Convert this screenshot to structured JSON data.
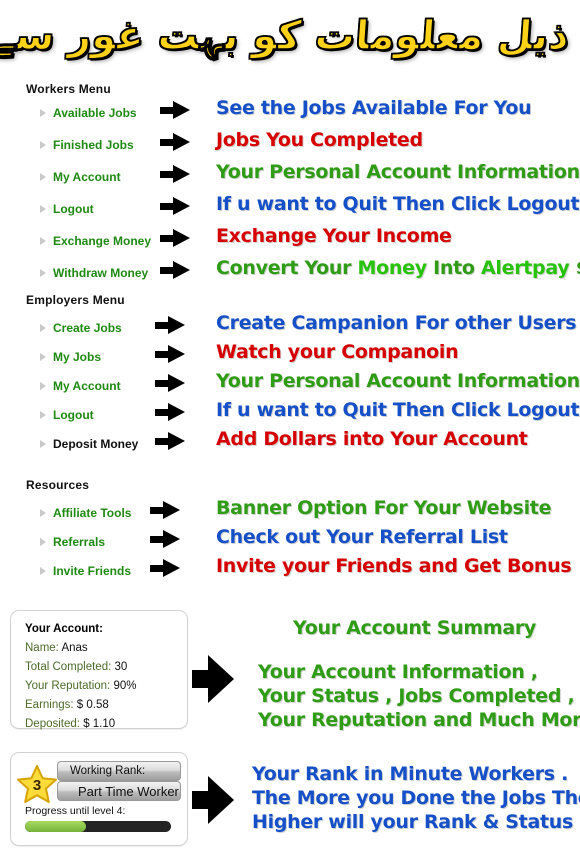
{
  "header": {
    "urdu_title": "مندرجہ ذیل معلومات کو بہت غور سے پڑھیں"
  },
  "sections": [
    {
      "title": "Workers Menu",
      "items": [
        {
          "label": "Available Jobs",
          "note": "See the Jobs Available For You",
          "color": "blue"
        },
        {
          "label": "Finished Jobs",
          "note": "Jobs You Completed",
          "color": "red"
        },
        {
          "label": "My Account",
          "note": "Your Personal Account Information",
          "color": "green"
        },
        {
          "label": "Logout",
          "note": "If u want to Quit Then Click Logout",
          "color": "blue"
        },
        {
          "label": "Exchange Money",
          "note": "Exchange Your Income",
          "color": "red"
        },
        {
          "label": "Withdraw Money",
          "note": "Convert Your Money Into Alertpay $",
          "color": "green"
        }
      ]
    },
    {
      "title": "Employers Menu",
      "items": [
        {
          "label": "Create Jobs",
          "note": "Create Campanion For other Users",
          "color": "blue"
        },
        {
          "label": "My Jobs",
          "note": "Watch your Companoin",
          "color": "red"
        },
        {
          "label": "My Account",
          "note": "Your Personal Account Information",
          "color": "green"
        },
        {
          "label": "Logout",
          "note": "If u want to Quit Then Click Logout",
          "color": "blue"
        },
        {
          "label": "Deposit Money",
          "note": "Add Dollars into Your Account",
          "color": "red"
        }
      ]
    },
    {
      "title": "Resources",
      "items": [
        {
          "label": "Affiliate Tools",
          "note": "Banner Option For Your Website",
          "color": "green"
        },
        {
          "label": "Referrals",
          "note": "Check out Your Referral List",
          "color": "blue"
        },
        {
          "label": "Invite Friends",
          "note": "Invite your Friends and Get Bonus",
          "color": "red"
        }
      ]
    }
  ],
  "account_card": {
    "title": "Your Account:",
    "rows": [
      {
        "label": "Name:",
        "value": "Anas"
      },
      {
        "label": "Total Completed:",
        "value": "30"
      },
      {
        "label": "Your Reputation:",
        "value": "90%"
      },
      {
        "label": "Earnings:",
        "value": "$ 0.58"
      },
      {
        "label": "Deposited:",
        "value": "$ 1.10"
      }
    ],
    "note_heading": "Your Account Summary",
    "note_lines": [
      "Your Account Information ,",
      "Your Status , Jobs Completed ,",
      "Your Reputation and Much More"
    ]
  },
  "rank_card": {
    "rank_label": "Working Rank:",
    "rank_title": "Part Time Worker",
    "star_level": "3",
    "progress_label": "Progress until level 4:",
    "progress_percent": 42,
    "note_lines": [
      "Your Rank in Minute Workers .",
      "The More you Done the Jobs The",
      "Higher will your Rank & Status"
    ]
  },
  "colors": {
    "blue": "#1550c8",
    "red": "#d60000",
    "green": "#2e9c14",
    "menu_green": "#1f8a12",
    "urdu_yellow": "#ffd21a",
    "progress_green": "#8bc34a"
  },
  "icons": {
    "chevron": "chevron-right-icon",
    "arrow": "arrow-right-icon",
    "star": "star-icon"
  }
}
